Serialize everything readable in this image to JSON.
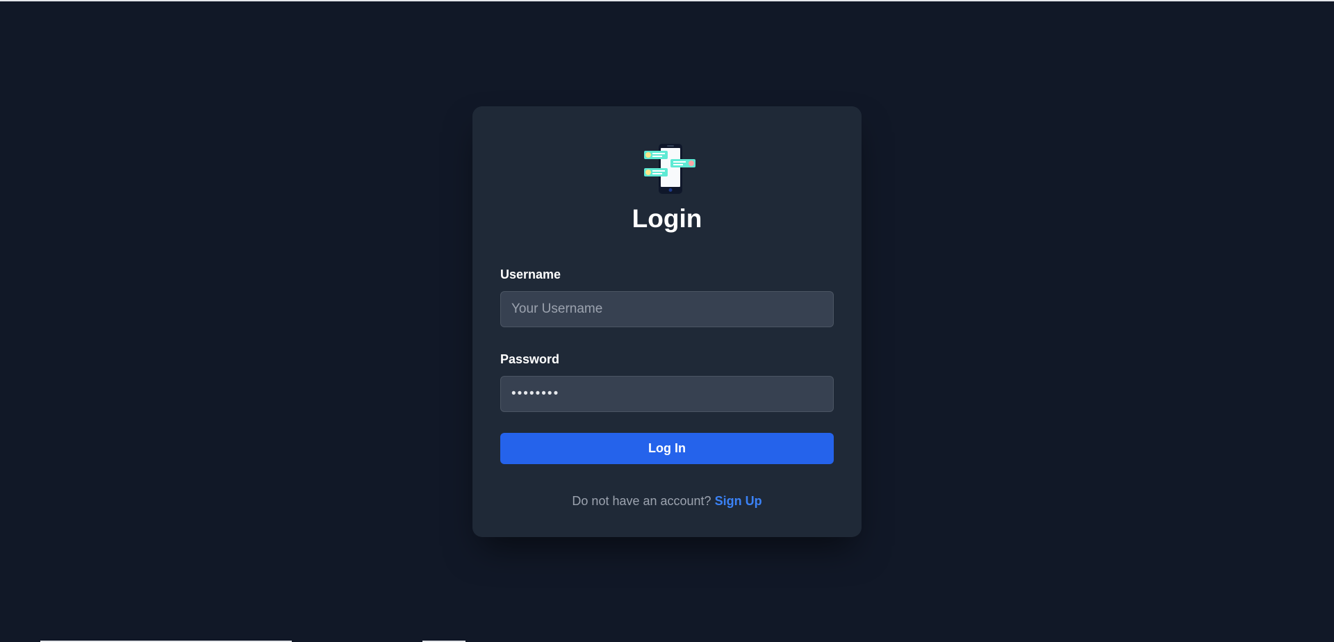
{
  "login": {
    "logo_icon": "chat-phone-icon",
    "title": "Login",
    "username_label": "Username",
    "username_placeholder": "Your Username",
    "username_value": "",
    "password_label": "Password",
    "password_placeholder": "",
    "password_value": "secret12",
    "submit_label": "Log In",
    "signup_prompt": "Do not have an account?",
    "signup_link": "Sign Up"
  },
  "colors": {
    "page_bg": "#111827",
    "card_bg": "#1f2937",
    "input_bg": "#374151",
    "accent": "#2563eb",
    "link": "#3b82f6",
    "logo_bubble": "#5eead4"
  }
}
